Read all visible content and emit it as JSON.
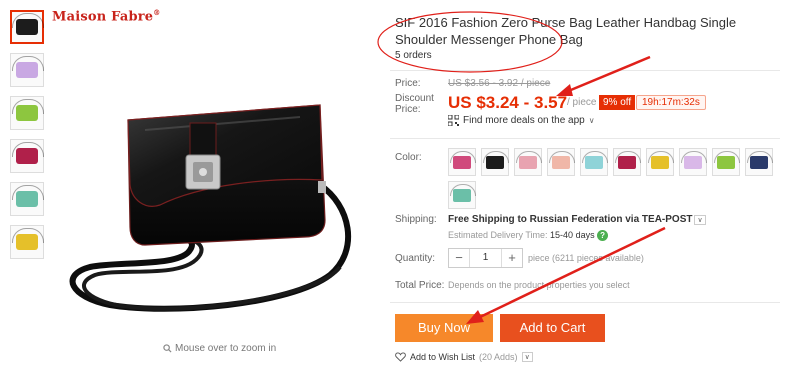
{
  "brand": {
    "logo_text": "Maison Fabre",
    "registered": "®"
  },
  "thumbnails": [
    {
      "color": "#1c1c1c",
      "active": true
    },
    {
      "color": "#c9a8e3"
    },
    {
      "color": "#8dc63f"
    },
    {
      "color": "#b0204a"
    },
    {
      "color": "#6bbfa8"
    },
    {
      "color": "#e5c02a"
    }
  ],
  "zoom_hint": "Mouse over to zoom in",
  "product": {
    "title": "SIF 2016 Fashion Zero Purse Bag Leather Handbag Single Shoulder Messenger Phone Bag",
    "orders": "5 orders"
  },
  "price": {
    "label": "Price:",
    "original": "US $3.56 - 3.92 / piece",
    "discount_label_1": "Discount",
    "discount_label_2": "Price:",
    "discount": "US $3.24 - 3.57",
    "unit": "/ piece",
    "off_badge": "9% off",
    "timer": "19h:17m:32s",
    "deals_link": "Find more deals on the app"
  },
  "color": {
    "label": "Color:",
    "swatches": [
      "#d04a7c",
      "#1c1c1c",
      "#e8a3b0",
      "#f0b7a8",
      "#8fd3d8",
      "#b0204a",
      "#e5c02a",
      "#d9b8e8",
      "#8dc63f",
      "#2a3a6a",
      "#6bbfa8"
    ]
  },
  "shipping": {
    "label": "Shipping:",
    "main": "Free Shipping to Russian Federation via TEA-POST",
    "caret": "∨",
    "delivery_label": "Estimated Delivery Time:",
    "delivery_value": "15-40",
    "delivery_unit": "days",
    "help": "?"
  },
  "quantity": {
    "label": "Quantity:",
    "minus": "−",
    "value": "1",
    "plus": "+",
    "available": "piece (6211 pieces available)"
  },
  "total": {
    "label": "Total Price:",
    "note": "Depends on the product properties you select"
  },
  "actions": {
    "buy_now": "Buy Now",
    "add_to_cart": "Add to Cart",
    "wishlist": "Add to Wish List",
    "wishlist_count": "(20 Adds)",
    "caret": "∨"
  },
  "colors": {
    "accent_red": "#e62e04",
    "buy_orange": "#f6882a",
    "cart_red": "#e8501e",
    "annotation_red": "#e0201a"
  }
}
